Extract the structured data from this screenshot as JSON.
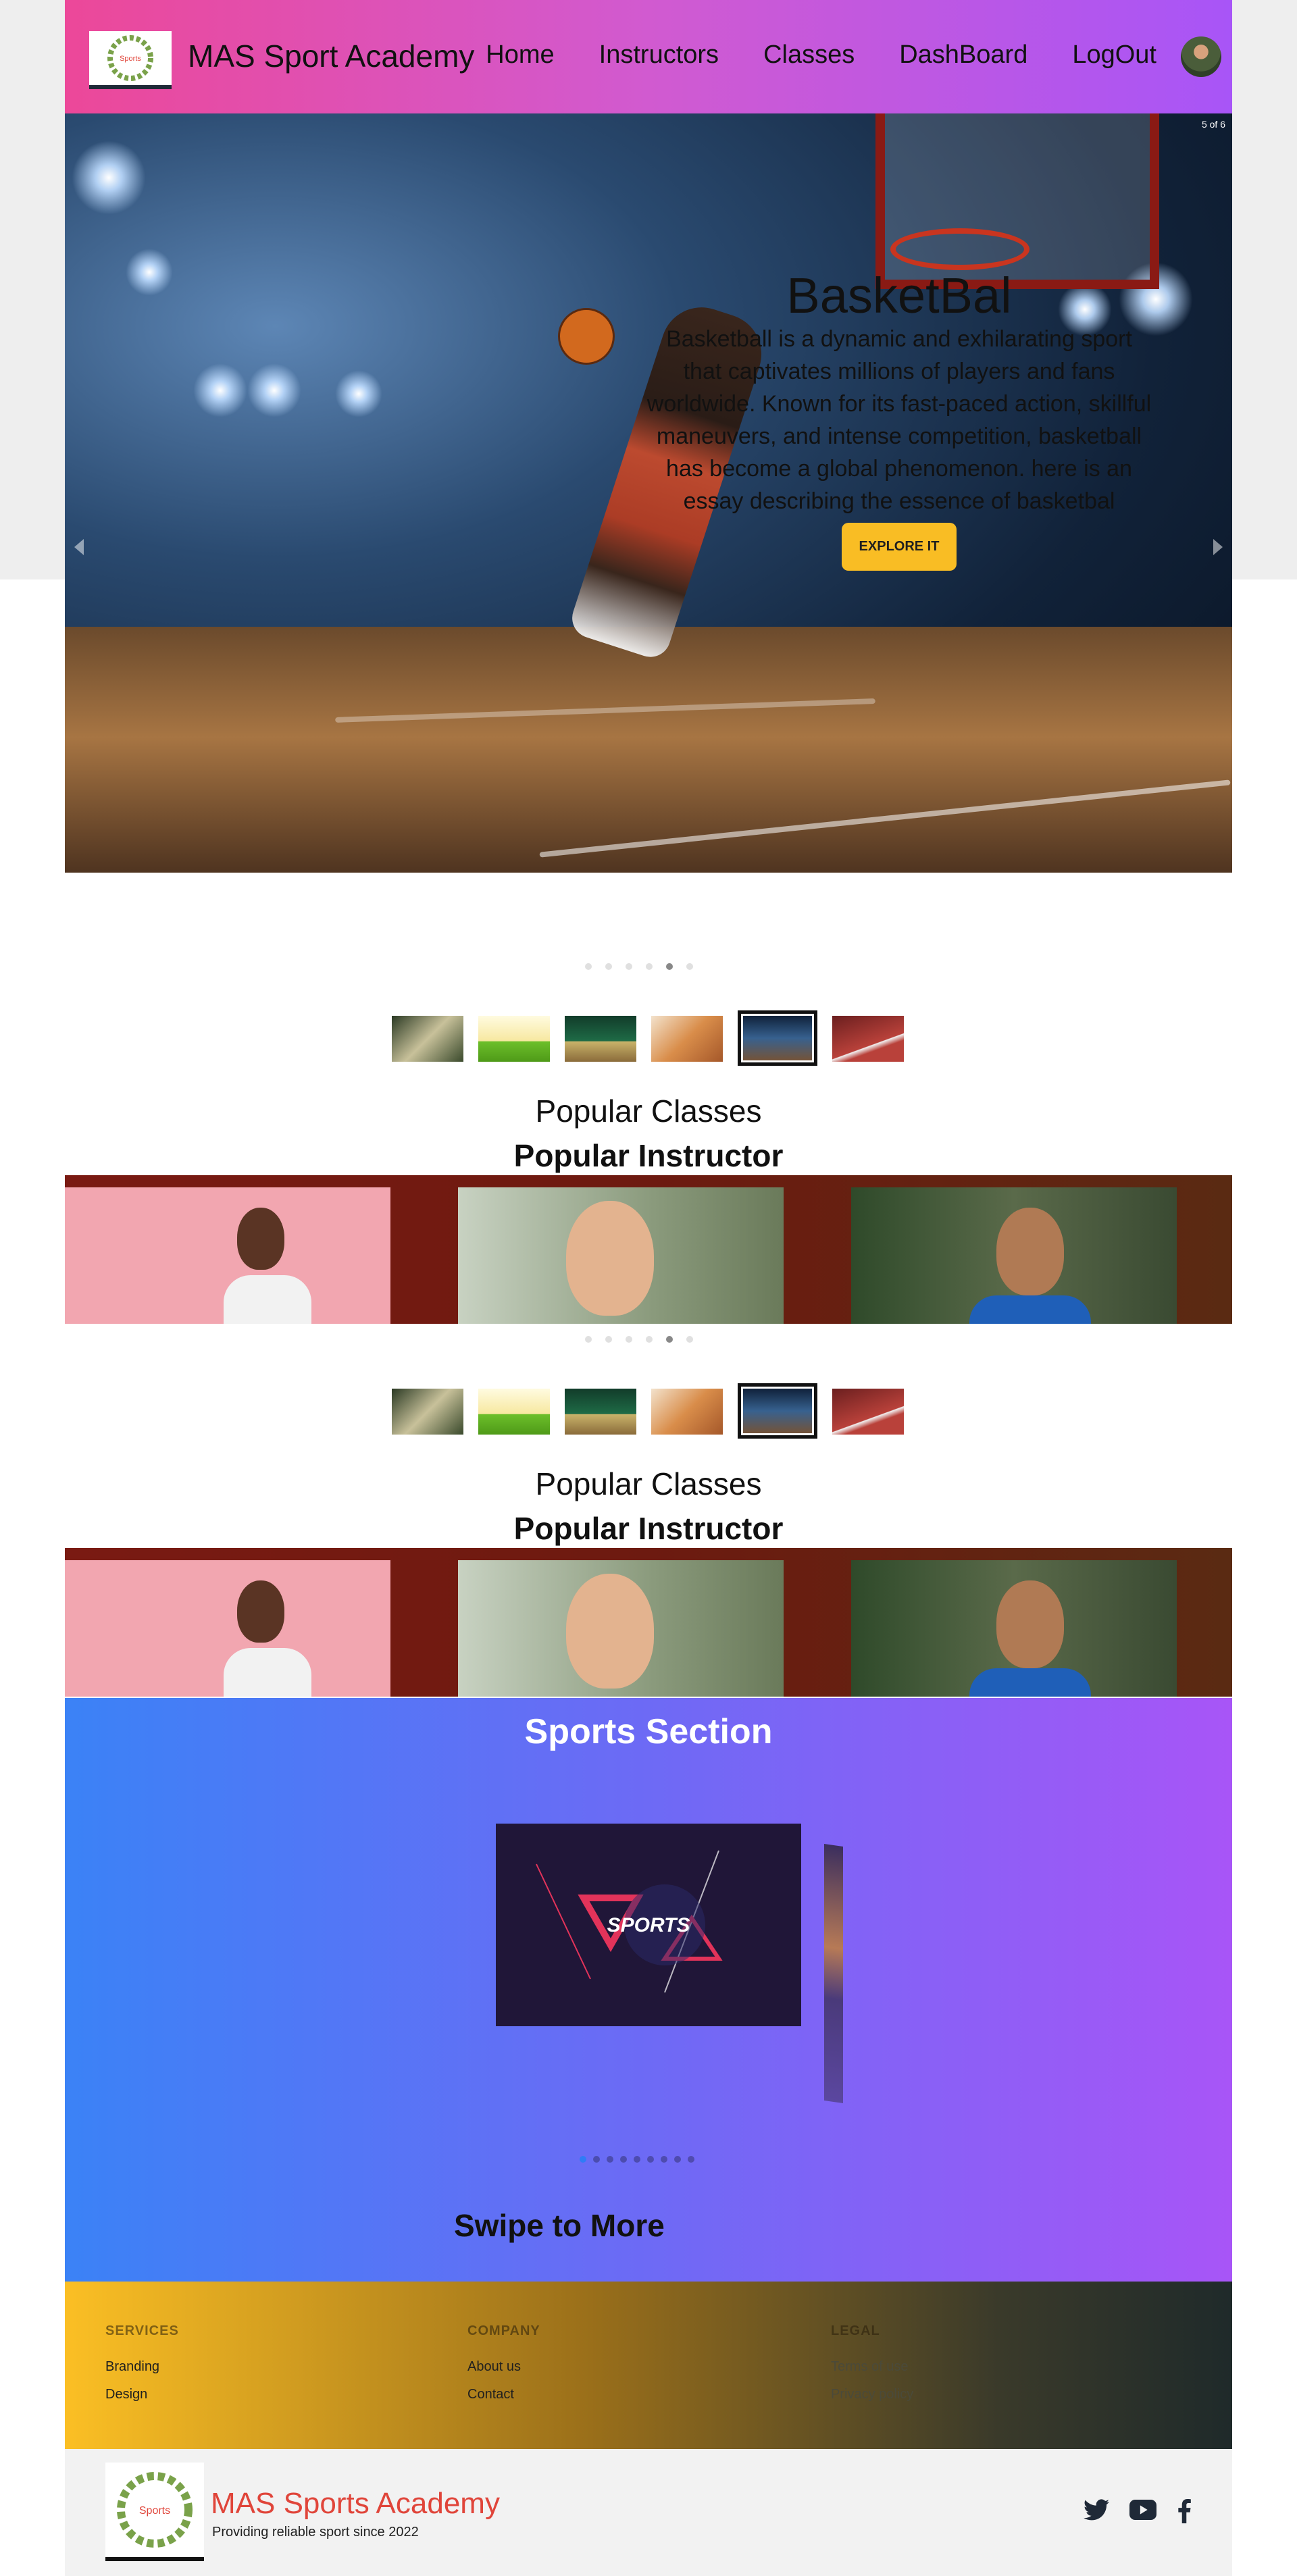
{
  "nav": {
    "logo_text": "Sports",
    "brand": "MAS Sport Academy",
    "links": [
      "Home",
      "Instructors",
      "Classes",
      "DashBoard",
      "LogOut"
    ]
  },
  "hero": {
    "counter": "5 of 6",
    "title": "BasketBal",
    "description": "Basketball is a dynamic and exhilarating sport that captivates millions of players and fans worldwide. Known for its fast-paced action, skillful maneuvers, and intense competition, basketball has become a global phenomenon. here is an essay describing the essence of basketbal",
    "cta": "EXPLORE IT",
    "slide_count": 6,
    "active_slide": 5
  },
  "sections": {
    "popular_classes": "Popular Classes",
    "popular_instructor": "Popular Instructor"
  },
  "sports": {
    "title": "Sports Section",
    "card_text": "SPORTS",
    "swipe": "Swipe to More",
    "dot_count": 9,
    "active_dot": 1
  },
  "footer": {
    "services": {
      "heading": "SERVICES",
      "links": [
        "Branding",
        "Design"
      ]
    },
    "company": {
      "heading": "COMPANY",
      "links": [
        "About us",
        "Contact"
      ]
    },
    "legal": {
      "heading": "LEGAL",
      "links": [
        "Terms of use",
        "Privacy policy"
      ]
    }
  },
  "bottom": {
    "logo_text": "Sports",
    "name": "MAS Sports Academy",
    "tagline": "Providing reliable sport since 2022",
    "social": [
      "twitter-icon",
      "youtube-icon",
      "facebook-icon"
    ]
  },
  "colors": {
    "nav_gradient": [
      "#ec4899",
      "#a855f7"
    ],
    "sports_gradient": [
      "#3b82f6",
      "#a855f7"
    ],
    "footer_gradient": [
      "#fbbf24",
      "#1f2a2a"
    ],
    "cta": "#f9bd24",
    "brand_red": "#e0453a"
  }
}
